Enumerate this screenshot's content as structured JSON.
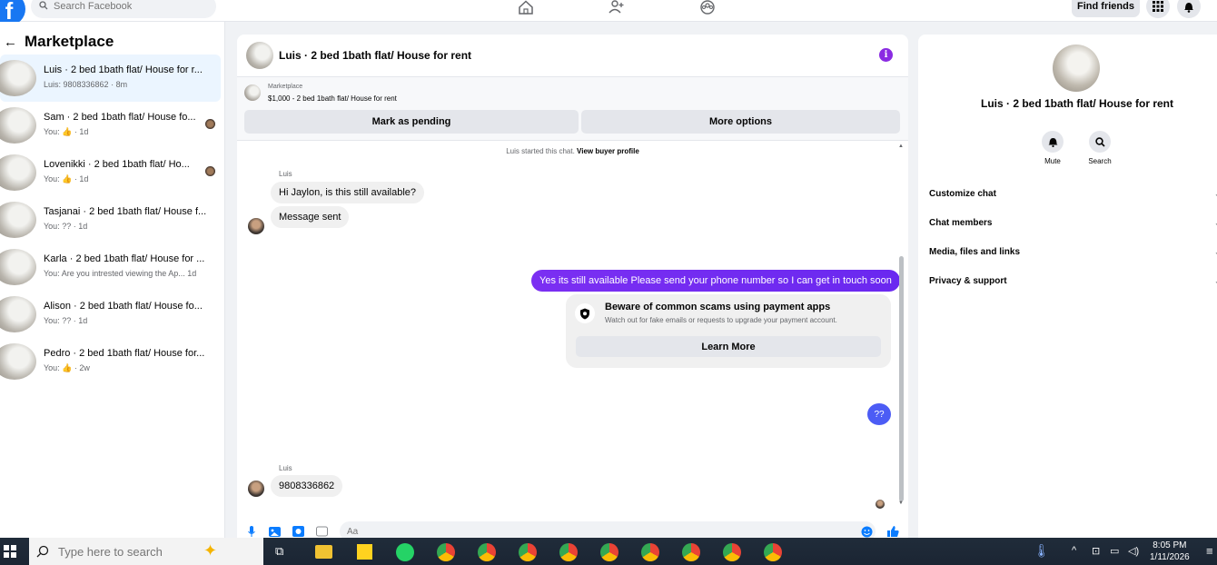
{
  "topbar": {
    "logo": "f",
    "search_placeholder": "Search Facebook",
    "find_friends": "Find friends",
    "icons": [
      "home-icon",
      "friends-icon",
      "groups-icon",
      "menu-grid-icon",
      "bell-icon"
    ]
  },
  "sidebar": {
    "title": "Marketplace",
    "conversations": [
      {
        "name": "Luis · 2 bed 1bath flat/ House for r...",
        "sub": "Luis: 9808336862 · 8m",
        "active": true
      },
      {
        "name": "Sam · 2 bed 1bath flat/ House fo...",
        "sub": "You: 👍 · 1d"
      },
      {
        "name": "Lovenikki · 2 bed 1bath flat/ Ho...",
        "sub": "You: 👍 · 1d"
      },
      {
        "name": "Tasjanai · 2 bed 1bath flat/ House f...",
        "sub": "You: ?? · 1d"
      },
      {
        "name": "Karla · 2 bed 1bath flat/ House for ...",
        "sub": "You: Are you intrested viewing the Ap...  1d"
      },
      {
        "name": "Alison · 2 bed 1bath flat/ House fo...",
        "sub": "You: ?? · 1d"
      },
      {
        "name": "Pedro · 2 bed 1bath flat/ House for...",
        "sub": "You: 👍 · 2w"
      }
    ]
  },
  "chat": {
    "title": "Luis · 2 bed 1bath flat/ House for rent",
    "listing_label": "Marketplace",
    "listing_price": "$1,000 - 2 bed 1bath flat/ House for rent",
    "mark_pending": "Mark as pending",
    "more_options": "More options",
    "system_note": "Luis started this chat.",
    "system_link": "View buyer profile",
    "sender1": "Luis",
    "msg1": "Hi Jaylon, is this still available?",
    "msg2": "Message sent",
    "out_msg": "Yes its still available Please send your phone number so I can get in touch soon",
    "scam_title": "Beware of common scams using payment apps",
    "scam_desc": "Watch out for fake emails or requests to upgrade your payment account.",
    "learn_more": "Learn More",
    "out_qq": "??",
    "sender2": "Luis",
    "msg3": "9808336862",
    "composer_placeholder": "Aa"
  },
  "rpanel": {
    "title": "Luis · 2 bed 1bath flat/ House for rent",
    "mute": "Mute",
    "search": "Search",
    "rows": [
      "Customize chat",
      "Chat members",
      "Media, files and links",
      "Privacy & support"
    ]
  },
  "taskbar": {
    "search_placeholder": "Type here to search",
    "time": "8:05 PM",
    "date": "1/11/2026"
  }
}
